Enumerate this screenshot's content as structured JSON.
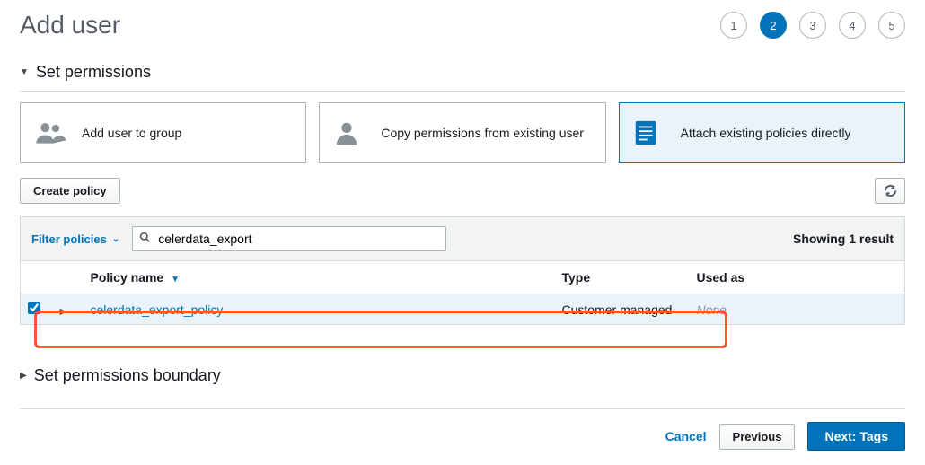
{
  "title": "Add user",
  "steps": [
    "1",
    "2",
    "3",
    "4",
    "5"
  ],
  "active_step": 2,
  "section_permissions": "Set permissions",
  "section_boundary": "Set permissions boundary",
  "options": {
    "group": "Add user to group",
    "copy": "Copy permissions from existing user",
    "attach": "Attach existing policies directly"
  },
  "toolbar": {
    "create_policy": "Create policy"
  },
  "filter": {
    "label": "Filter policies",
    "search_value": "celerdata_export",
    "result_text": "Showing 1 result"
  },
  "table": {
    "headers": {
      "name": "Policy name",
      "type": "Type",
      "used": "Used as"
    },
    "rows": [
      {
        "checked": true,
        "name": "celerdata_export_policy",
        "type": "Customer managed",
        "used": "None"
      }
    ]
  },
  "footer": {
    "cancel": "Cancel",
    "previous": "Previous",
    "next": "Next: Tags"
  }
}
